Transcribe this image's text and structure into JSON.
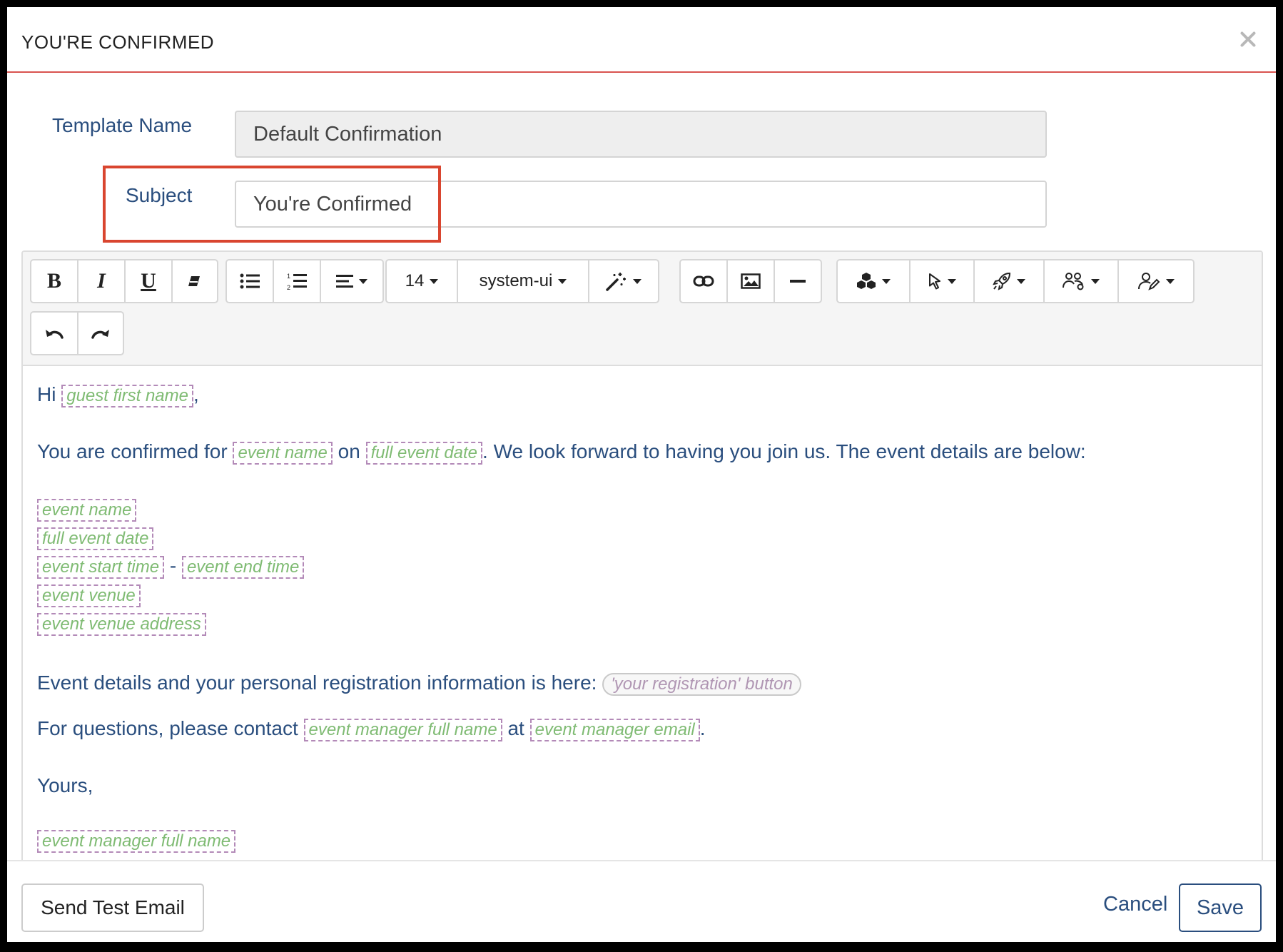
{
  "modal": {
    "title": "YOU'RE CONFIRMED"
  },
  "form": {
    "template_name_label": "Template Name",
    "template_name_value": "Default Confirmation",
    "subject_label": "Subject",
    "subject_value": "You're Confirmed"
  },
  "toolbar": {
    "font_size": "14",
    "font_family": "system-ui",
    "icons": [
      "bold-icon",
      "italic-icon",
      "underline-icon",
      "eraser-icon",
      "bullet-list-icon",
      "numbered-list-icon",
      "align-icon",
      "magic-wand-icon",
      "link-icon",
      "image-icon",
      "horizontal-rule-icon",
      "blocks-icon",
      "cursor-icon",
      "rocket-icon",
      "people-gear-icon",
      "person-edit-icon",
      "undo-icon",
      "redo-icon"
    ]
  },
  "body": {
    "greeting_prefix": "Hi",
    "greeting_suffix": ",",
    "tag_guest_first_name": "guest first name",
    "confirm_prefix": "You are confirmed for",
    "tag_event_name": "event name",
    "on": "on",
    "tag_full_event_date": "full event date",
    "confirm_suffix": ". We look forward to having you join us. The event details are below:",
    "tag_event_start_time": "event start time",
    "dash": "-",
    "tag_event_end_time": "event end time",
    "tag_event_venue": "event venue",
    "tag_event_venue_address": "event venue address",
    "details_text": "Event details and your personal registration information is here:",
    "tag_registration_button": "'your registration' button",
    "questions_prefix": "For questions, please contact",
    "tag_event_manager_full_name": "event manager full name",
    "at": "at",
    "tag_event_manager_email": "event manager email",
    "period": ".",
    "yours": "Yours,"
  },
  "footer": {
    "send_test_email": "Send Test Email",
    "cancel": "Cancel",
    "save": "Save"
  }
}
